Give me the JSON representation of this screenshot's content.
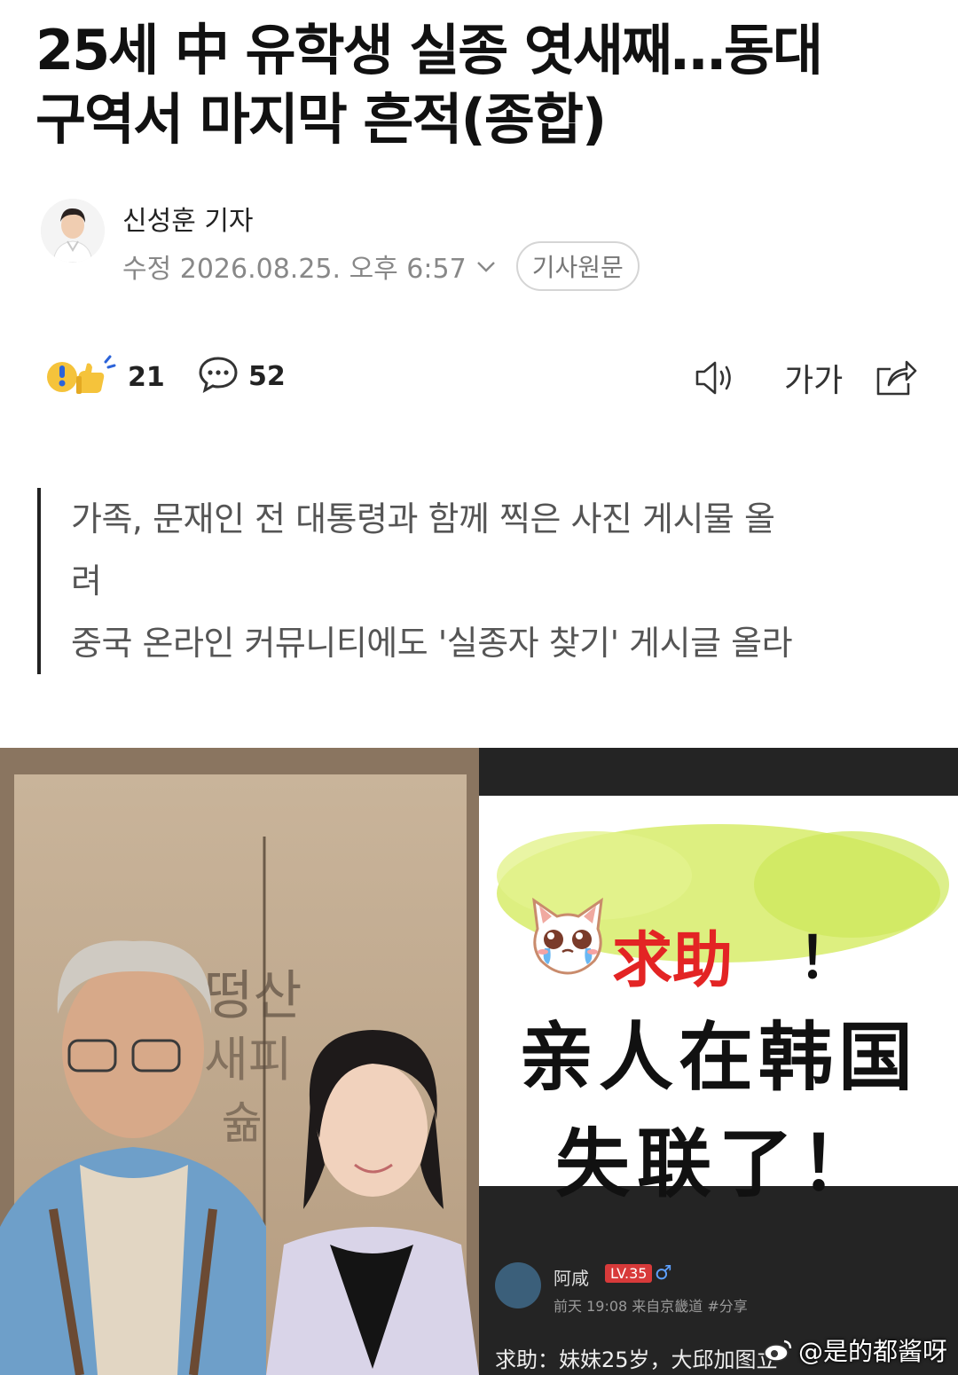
{
  "article": {
    "headline_line1": "25세 中 유학생 실종 엿새째…동대",
    "headline_line2": "구역서 마지막 흔적(종합)",
    "reporter": "신성훈 기자",
    "timestamp": "수정 2026.08.25. 오후 6:57",
    "original_button": "기사원문",
    "reaction_count": "21",
    "comment_count": "52",
    "font_size_label": "가가",
    "summary": [
      "가족, 문재인 전 대통령과 함께 찍은 사진 게시물 올",
      "려",
      "중국 온라인 커뮤니티에도 '실종자 찾기' 게시글 올라"
    ]
  },
  "image": {
    "help_title": "求助",
    "help_bang": "！",
    "cn_line1": "亲人在韩国",
    "cn_line2": "失联了！",
    "post_user": "阿咸",
    "post_level": "LV.35",
    "post_gender": "♂",
    "post_meta": "前天 19:08  来自京畿道 #分享",
    "post_text": "求助：妹妹25岁，大邱加图立",
    "watermark": "@是的都酱呀"
  },
  "colors": {
    "accent_red": "#e32424",
    "text_dark": "#111111",
    "text_gray": "#888888",
    "quote_bar": "#222222"
  },
  "icons": [
    "reporter-avatar",
    "chevron-down-icon",
    "emoji-reaction-icon",
    "comment-bubble-icon",
    "speaker-icon",
    "font-size-icon",
    "share-icon",
    "crying-cat-icon",
    "weibo-icon"
  ]
}
